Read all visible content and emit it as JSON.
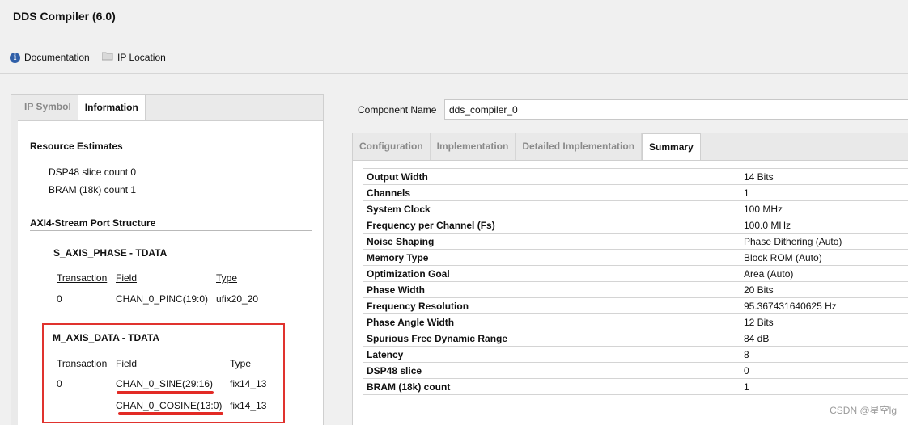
{
  "window": {
    "title": "DDS Compiler (6.0)"
  },
  "toolbar": {
    "documentation": "Documentation",
    "ip_location": "IP Location"
  },
  "left": {
    "tabs": [
      "IP Symbol",
      "Information"
    ],
    "active_tab": "Information",
    "resource_title": "Resource Estimates",
    "resources": [
      "DSP48 slice count 0",
      "BRAM (18k) count 1"
    ],
    "port_title": "AXI4-Stream Port Structure",
    "s_axis": {
      "title": "S_AXIS_PHASE - TDATA",
      "headers": [
        "Transaction",
        "Field",
        "Type"
      ],
      "rows": [
        [
          "0",
          "CHAN_0_PINC(19:0)",
          "ufix20_20"
        ]
      ]
    },
    "m_axis": {
      "title": "M_AXIS_DATA - TDATA",
      "headers": [
        "Transaction",
        "Field",
        "Type"
      ],
      "rows": [
        [
          "0",
          "CHAN_0_SINE(29:16)",
          "fix14_13"
        ],
        [
          "",
          "CHAN_0_COSINE(13:0)",
          "fix14_13"
        ]
      ]
    }
  },
  "right": {
    "component_name_label": "Component Name",
    "component_name_value": "dds_compiler_0",
    "tabs": [
      "Configuration",
      "Implementation",
      "Detailed Implementation",
      "Summary"
    ],
    "active_tab": "Summary",
    "summary": [
      [
        "Output Width",
        "14 Bits"
      ],
      [
        "Channels",
        "1"
      ],
      [
        "System Clock",
        "100 MHz"
      ],
      [
        "Frequency per Channel (Fs)",
        "100.0 MHz"
      ],
      [
        "Noise Shaping",
        "Phase Dithering (Auto)"
      ],
      [
        "Memory Type",
        "Block ROM (Auto)"
      ],
      [
        "Optimization Goal",
        "Area (Auto)"
      ],
      [
        "Phase Width",
        "20 Bits"
      ],
      [
        "Frequency Resolution",
        "95.367431640625 Hz"
      ],
      [
        "Phase Angle Width",
        "12 Bits"
      ],
      [
        "Spurious Free Dynamic Range",
        "84 dB"
      ],
      [
        "Latency",
        "8"
      ],
      [
        "DSP48 slice",
        "0"
      ],
      [
        "BRAM (18k) count",
        "1"
      ]
    ]
  },
  "watermark": "CSDN @星空lg",
  "colors": {
    "highlight": "#e0332e",
    "info_icon": "#2f5fa8"
  }
}
